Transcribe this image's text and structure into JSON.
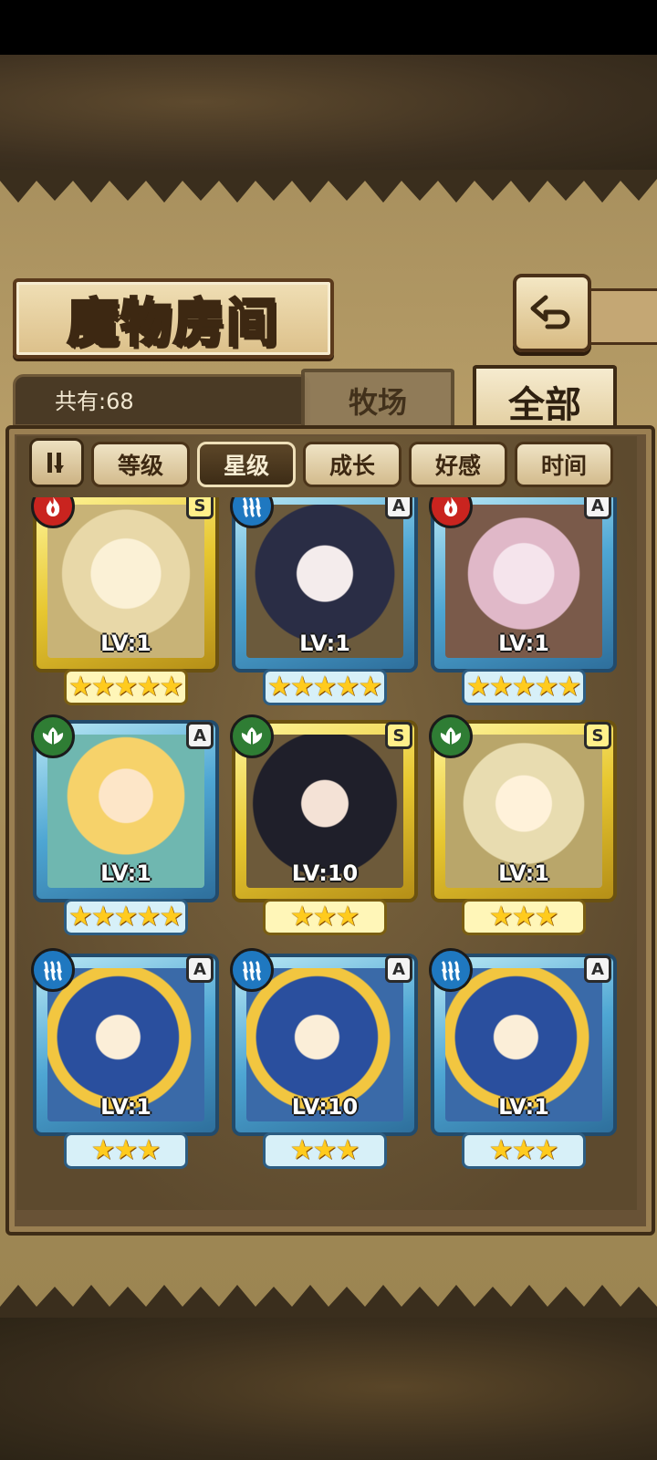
{
  "title": "魔物房间",
  "count_label": "共有:68",
  "tabs": [
    {
      "label": "牧场",
      "active": false
    },
    {
      "label": "全部",
      "active": true
    }
  ],
  "sort_buttons": [
    {
      "label": "等级",
      "active": false
    },
    {
      "label": "星级",
      "active": true
    },
    {
      "label": "成长",
      "active": false
    },
    {
      "label": "好感",
      "active": false
    },
    {
      "label": "时间",
      "active": false
    }
  ],
  "icons": {
    "back": "back-arrow-icon",
    "sort_order": "sort-order-icon",
    "fire": "fire-element-icon",
    "water": "water-element-icon",
    "wood": "leaf-element-icon"
  },
  "colors": {
    "frame_blue": "#4ea6d3",
    "frame_gold": "#e7c730",
    "fire": "#c9241f",
    "water": "#1f78c0",
    "wood": "#2f7d34",
    "star": "#ffcb1e"
  },
  "monsters": [
    {
      "level": "LV:1",
      "rank": "S",
      "element": "fire",
      "stars": 5,
      "frame": "gold",
      "portrait": "blonde-girl-captain-hat"
    },
    {
      "level": "LV:1",
      "rank": "A",
      "element": "water",
      "stars": 5,
      "frame": "blue",
      "portrait": "eyepatch-dark-hair-girl"
    },
    {
      "level": "LV:1",
      "rank": "A",
      "element": "fire",
      "stars": 5,
      "frame": "blue",
      "portrait": "horned-demon-girl"
    },
    {
      "level": "LV:1",
      "rank": "A",
      "element": "wood",
      "stars": 5,
      "frame": "blue",
      "portrait": "mermaid-blonde-girl"
    },
    {
      "level": "LV:10",
      "rank": "S",
      "element": "wood",
      "stars": 3,
      "frame": "gold",
      "portrait": "long-black-hair-girl"
    },
    {
      "level": "LV:1",
      "rank": "S",
      "element": "wood",
      "stars": 3,
      "frame": "gold",
      "portrait": "crying-fairy-girl"
    },
    {
      "level": "LV:1",
      "rank": "A",
      "element": "water",
      "stars": 3,
      "frame": "blue",
      "portrait": "blue-cat-girl-bell"
    },
    {
      "level": "LV:10",
      "rank": "A",
      "element": "water",
      "stars": 3,
      "frame": "blue",
      "portrait": "blue-cat-girl-bell"
    },
    {
      "level": "LV:1",
      "rank": "A",
      "element": "water",
      "stars": 3,
      "frame": "blue",
      "portrait": "blue-cat-girl-bell"
    }
  ]
}
